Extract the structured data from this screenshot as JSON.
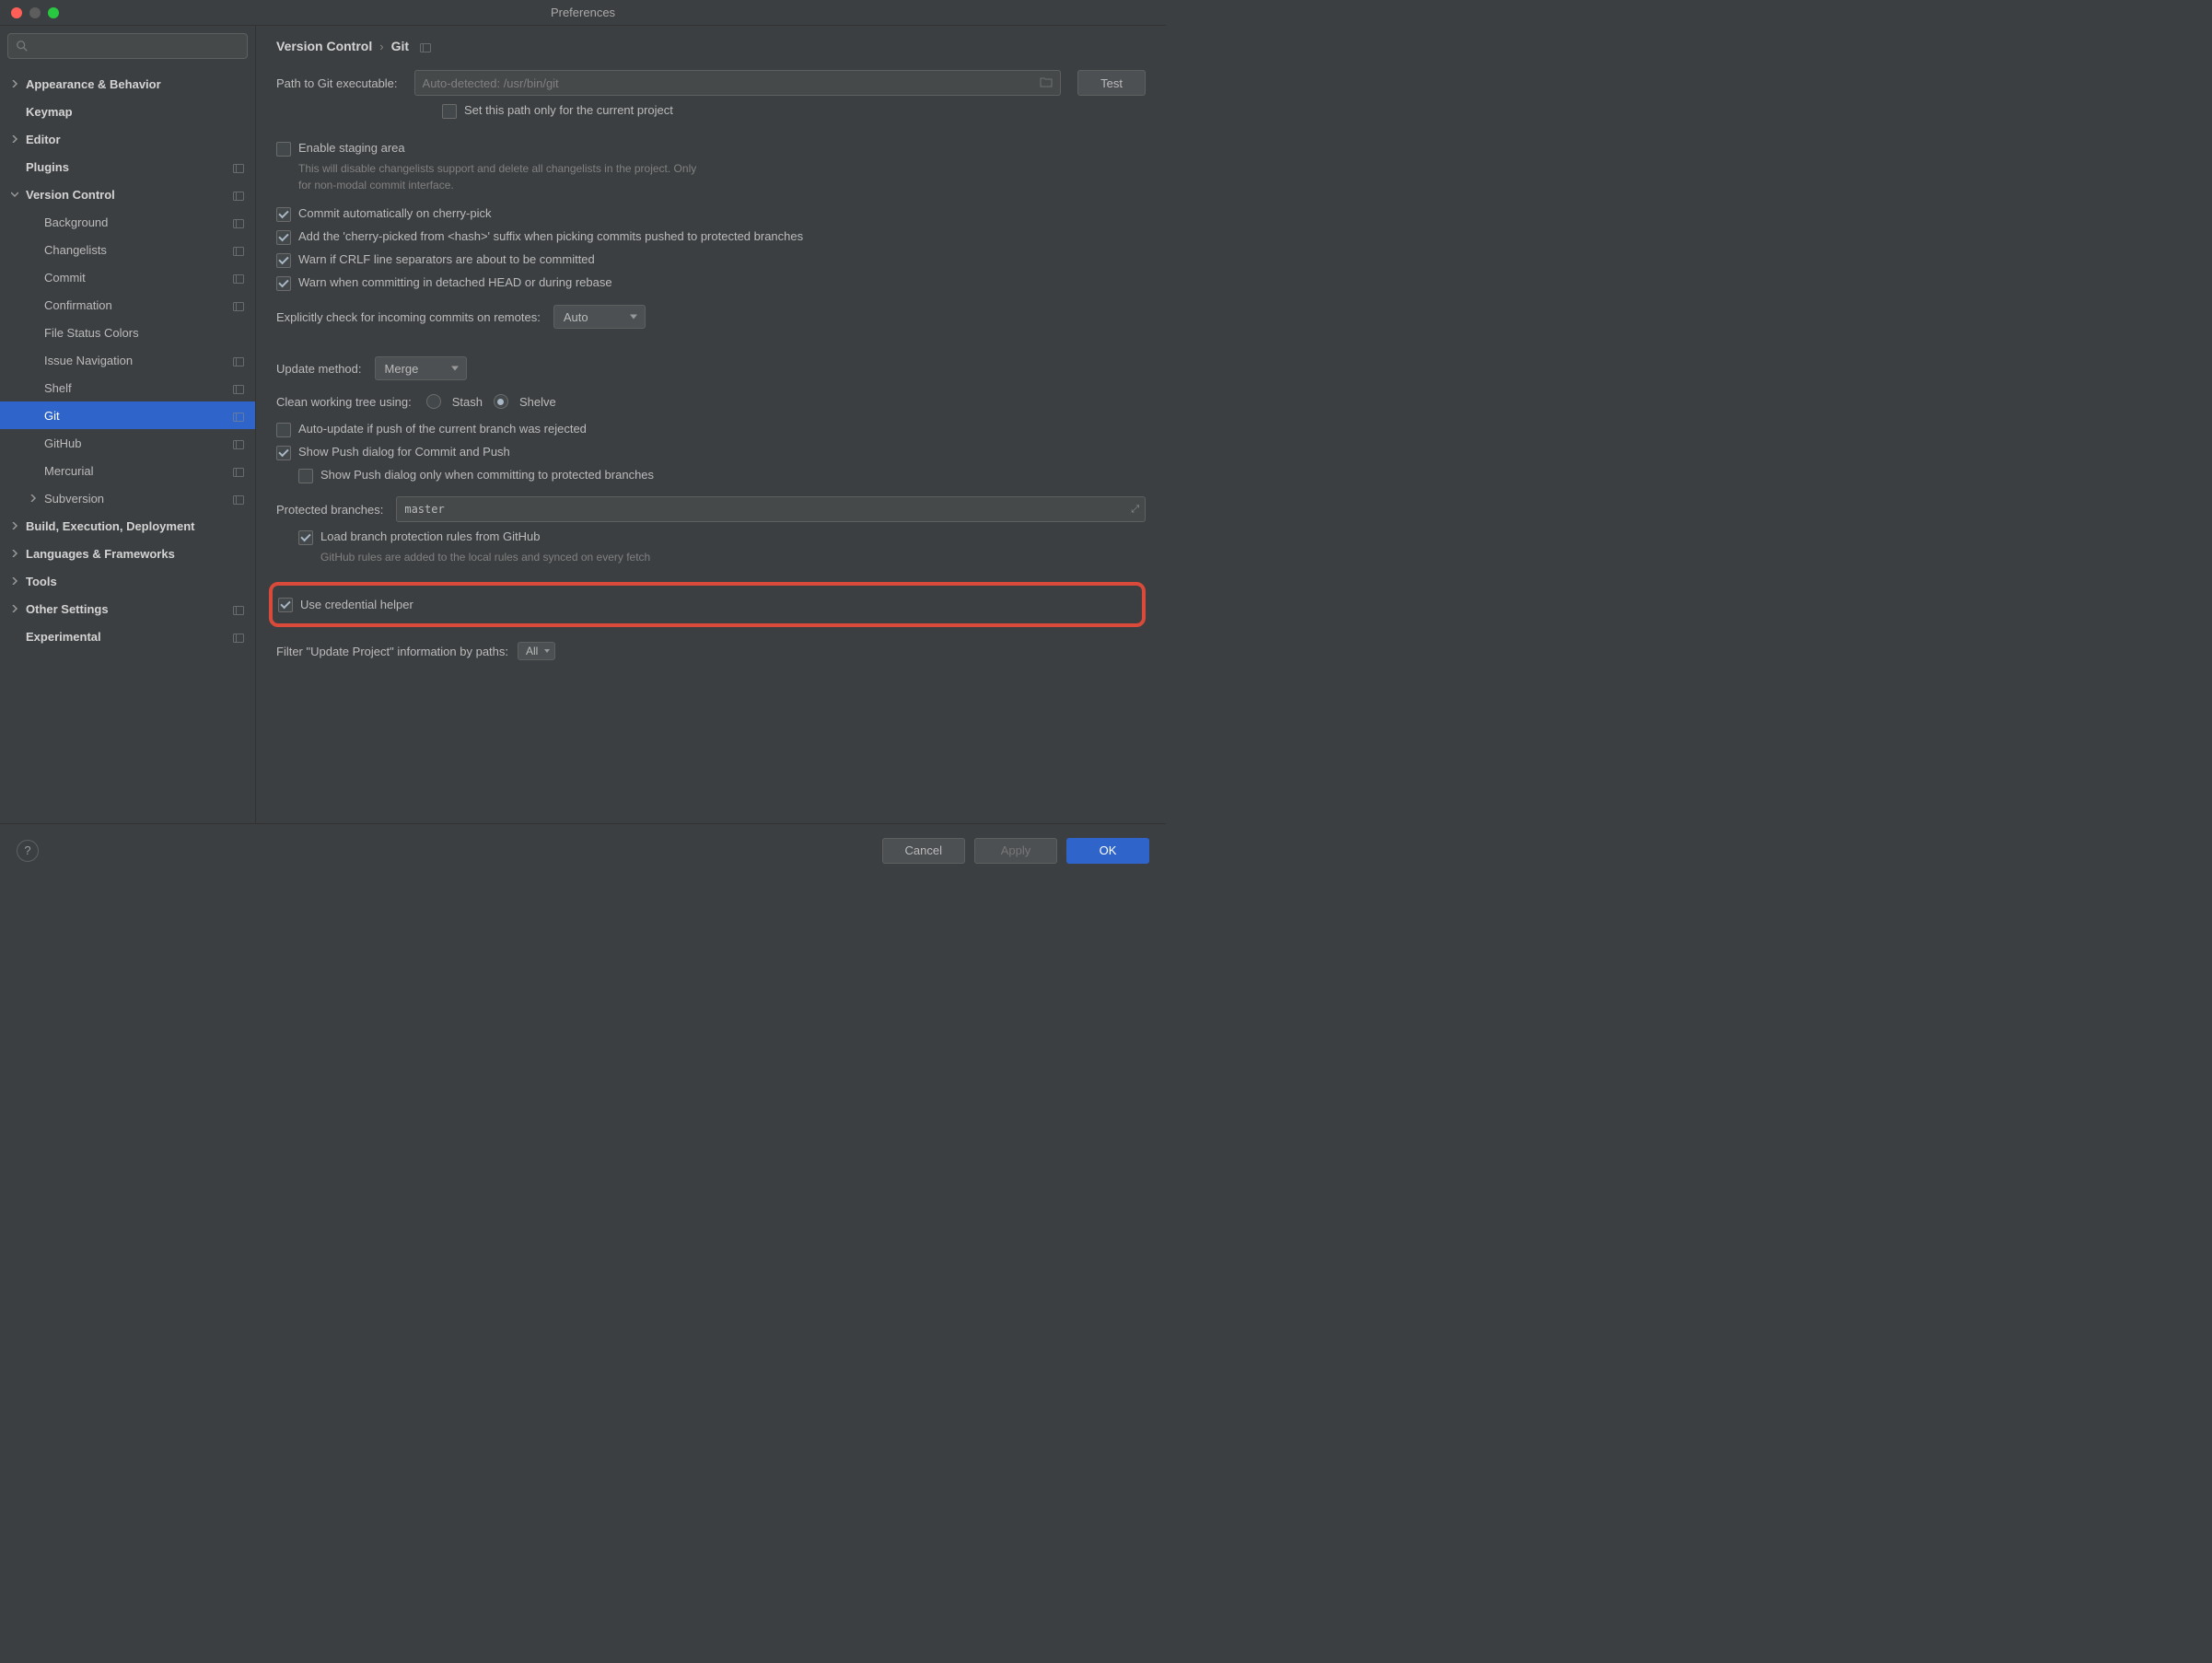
{
  "window": {
    "title": "Preferences"
  },
  "breadcrumb": {
    "root": "Version Control",
    "leaf": "Git"
  },
  "sidebar": {
    "items": [
      {
        "label": "Appearance & Behavior",
        "bold": true,
        "chevron": "right",
        "indent": 0
      },
      {
        "label": "Keymap",
        "bold": true,
        "indent": 0
      },
      {
        "label": "Editor",
        "bold": true,
        "chevron": "right",
        "indent": 0
      },
      {
        "label": "Plugins",
        "bold": true,
        "indent": 0,
        "proj": true
      },
      {
        "label": "Version Control",
        "bold": true,
        "chevron": "down",
        "indent": 0,
        "proj": true
      },
      {
        "label": "Background",
        "indent": 1,
        "proj": true
      },
      {
        "label": "Changelists",
        "indent": 1,
        "proj": true
      },
      {
        "label": "Commit",
        "indent": 1,
        "proj": true
      },
      {
        "label": "Confirmation",
        "indent": 1,
        "proj": true
      },
      {
        "label": "File Status Colors",
        "indent": 1
      },
      {
        "label": "Issue Navigation",
        "indent": 1,
        "proj": true
      },
      {
        "label": "Shelf",
        "indent": 1,
        "proj": true
      },
      {
        "label": "Git",
        "indent": 1,
        "proj": true,
        "selected": true
      },
      {
        "label": "GitHub",
        "indent": 1,
        "proj": true
      },
      {
        "label": "Mercurial",
        "indent": 1,
        "proj": true
      },
      {
        "label": "Subversion",
        "chevron": "right",
        "indent": 1,
        "proj": true
      },
      {
        "label": "Build, Execution, Deployment",
        "bold": true,
        "chevron": "right",
        "indent": 0
      },
      {
        "label": "Languages & Frameworks",
        "bold": true,
        "chevron": "right",
        "indent": 0
      },
      {
        "label": "Tools",
        "bold": true,
        "chevron": "right",
        "indent": 0
      },
      {
        "label": "Other Settings",
        "bold": true,
        "chevron": "right",
        "indent": 0,
        "proj": true
      },
      {
        "label": "Experimental",
        "bold": true,
        "indent": 0,
        "proj": true
      }
    ]
  },
  "git": {
    "path_label": "Path to Git executable:",
    "path_placeholder": "Auto-detected: /usr/bin/git",
    "test_btn": "Test",
    "set_path_project_only": "Set this path only for the current project",
    "enable_staging": "Enable staging area",
    "enable_staging_hint": "This will disable changelists support and delete all changelists in the project. Only for non-modal commit interface.",
    "commit_cherry": "Commit automatically on cherry-pick",
    "cherry_suffix": "Add the 'cherry-picked from <hash>' suffix when picking commits pushed to protected branches",
    "warn_crlf": "Warn if CRLF line separators are about to be committed",
    "warn_detached": "Warn when committing in detached HEAD or during rebase",
    "explicit_check_label": "Explicitly check for incoming commits on remotes:",
    "explicit_check_value": "Auto",
    "update_method_label": "Update method:",
    "update_method_value": "Merge",
    "clean_tree_label": "Clean working tree using:",
    "clean_tree_stash": "Stash",
    "clean_tree_shelve": "Shelve",
    "auto_update_rejected": "Auto-update if push of the current branch was rejected",
    "show_push_dialog": "Show Push dialog for Commit and Push",
    "show_push_protected": "Show Push dialog only when committing to protected branches",
    "protected_branches_label": "Protected branches:",
    "protected_branches_value": "master",
    "load_branch_rules": "Load branch protection rules from GitHub",
    "load_branch_rules_hint": "GitHub rules are added to the local rules and synced on every fetch",
    "use_credential_helper": "Use credential helper",
    "filter_update_label": "Filter \"Update Project\" information by paths:",
    "filter_update_value": "All"
  },
  "footer": {
    "cancel": "Cancel",
    "apply": "Apply",
    "ok": "OK"
  }
}
